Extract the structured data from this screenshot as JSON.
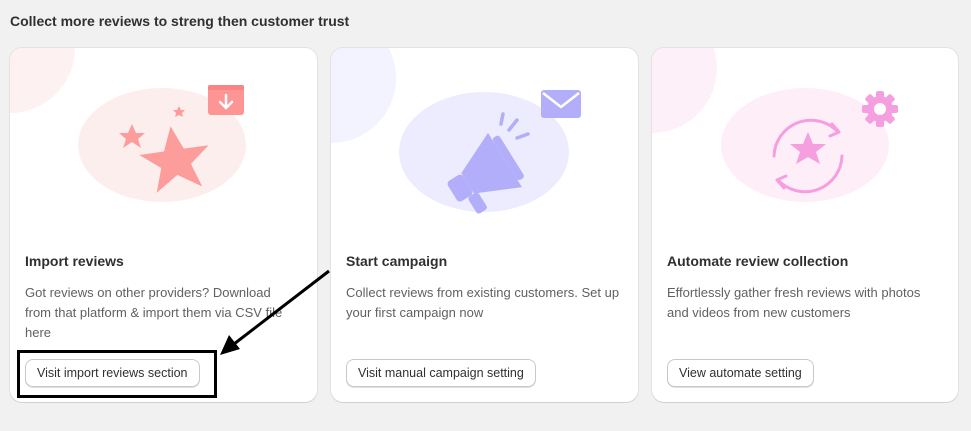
{
  "section": {
    "title": "Collect more reviews to streng then customer trust"
  },
  "cards": [
    {
      "title": "Import reviews",
      "description": "Got reviews on other providers? Download from that platform & import them via CSV file here",
      "button": "Visit import reviews section",
      "icon": "star-import-icon",
      "accent": "#fd9d9b"
    },
    {
      "title": "Start campaign",
      "description": "Collect reviews from existing customers. Set up your first campaign now",
      "button": "Visit manual campaign setting",
      "icon": "megaphone-icon",
      "accent": "#b2aefa"
    },
    {
      "title": "Automate review collection",
      "description": "Effortlessly gather fresh reviews with photos and videos from new customers",
      "button": "View automate setting",
      "icon": "auto-cycle-star-icon",
      "accent": "#f59ee0"
    }
  ],
  "colors": {
    "background": "#f1f1f1",
    "card": "#ffffff",
    "annotation": "#000000"
  }
}
